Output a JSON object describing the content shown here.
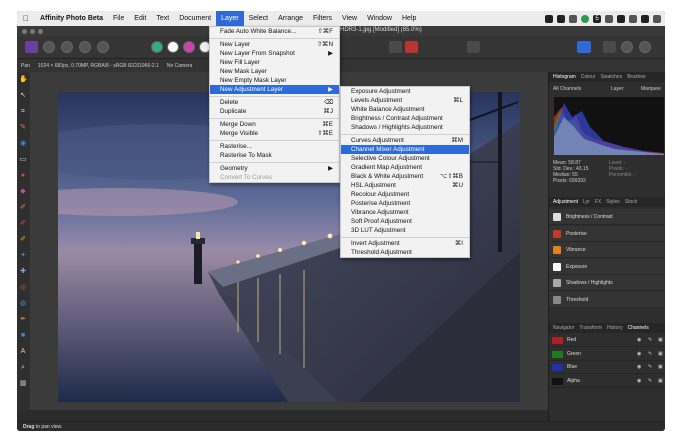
{
  "menubar": {
    "apple": "",
    "items": [
      "Affinity Photo Beta",
      "File",
      "Edit",
      "Text",
      "Document",
      "Layer",
      "Select",
      "Arrange",
      "Filters",
      "View",
      "Window",
      "Help"
    ],
    "active_index": 5
  },
  "titlebar": {
    "doc_title": "HDR3-1.jpg [Modified] (85.0%)"
  },
  "context": {
    "tool_name": "Pan",
    "doc_info": "1024 × 683px, 0.70MP, RGBA/8 - sRGB IEC61966-2.1",
    "camera": "No Camera"
  },
  "layer_menu": {
    "items": [
      {
        "label": "Fade Auto White Balance...",
        "shortcut": "⇧⌘F"
      },
      {
        "sep": true
      },
      {
        "label": "New Layer",
        "shortcut": "⇧⌘N"
      },
      {
        "label": "New Layer From Snapshot",
        "shortcut": "▶"
      },
      {
        "label": "New Fill Layer",
        "shortcut": ""
      },
      {
        "label": "New Mask Layer",
        "shortcut": ""
      },
      {
        "label": "New Empty Mask Layer",
        "shortcut": ""
      },
      {
        "label": "New Adjustment Layer",
        "shortcut": "▶",
        "highlight": true
      },
      {
        "sep": true
      },
      {
        "label": "Delete",
        "shortcut": "⌫"
      },
      {
        "label": "Duplicate",
        "shortcut": "⌘J"
      },
      {
        "sep": true
      },
      {
        "label": "Merge Down",
        "shortcut": "⌘E"
      },
      {
        "label": "Merge Visible",
        "shortcut": "⇧⌘E"
      },
      {
        "sep": true
      },
      {
        "label": "Rasterise...",
        "shortcut": ""
      },
      {
        "label": "Rasterise To Mask",
        "shortcut": ""
      },
      {
        "sep": true
      },
      {
        "label": "Geometry",
        "shortcut": "▶"
      },
      {
        "label": "Convert To Curves",
        "shortcut": "",
        "disabled": true
      }
    ]
  },
  "adjustment_menu": {
    "items": [
      {
        "label": "Exposure Adjustment",
        "shortcut": ""
      },
      {
        "label": "Levels Adjustment",
        "shortcut": "⌘L"
      },
      {
        "label": "White Balance Adjustment",
        "shortcut": ""
      },
      {
        "label": "Brightness / Contrast Adjustment",
        "shortcut": ""
      },
      {
        "label": "Shadows / Highlights Adjustment",
        "shortcut": ""
      },
      {
        "sep": true
      },
      {
        "label": "Curves Adjustment",
        "shortcut": "⌘M"
      },
      {
        "label": "Channel Mixer Adjustment",
        "shortcut": "",
        "highlight": true
      },
      {
        "label": "Selective Colour Adjustment",
        "shortcut": ""
      },
      {
        "label": "Gradient Map Adjustment",
        "shortcut": ""
      },
      {
        "label": "Black & White Adjustment",
        "shortcut": "⌥⇧⌘B"
      },
      {
        "label": "HSL Adjustment",
        "shortcut": "⌘U"
      },
      {
        "label": "Recolour Adjustment",
        "shortcut": ""
      },
      {
        "label": "Posterise Adjustment",
        "shortcut": ""
      },
      {
        "label": "Vibrance Adjustment",
        "shortcut": ""
      },
      {
        "label": "Soft Proof Adjustment",
        "shortcut": ""
      },
      {
        "label": "3D LUT Adjustment",
        "shortcut": ""
      },
      {
        "sep": true
      },
      {
        "label": "Invert Adjustment",
        "shortcut": "⌘I"
      },
      {
        "label": "Threshold Adjustment",
        "shortcut": ""
      }
    ]
  },
  "histogram_panel": {
    "tabs": [
      "Histogram",
      "Colour",
      "Swatches",
      "Brushes"
    ],
    "channel_select": "All Channels",
    "layer_label": "Layer",
    "marquee_label": "Marquee",
    "stats_left": [
      "Mean: 58.87",
      "Std. Dev.: 43.15",
      "Median: 55",
      "Pixels: 699392"
    ],
    "stats_right": [
      "Level: -",
      "Pixels: -",
      "Percentile: -"
    ]
  },
  "adjustment_panel": {
    "tabs": [
      "Adjustment",
      "Lyr",
      "FX",
      "Styles",
      "Stock"
    ],
    "items": [
      {
        "label": "Brightness / Contrast",
        "color": "#dddddd"
      },
      {
        "label": "Posterise",
        "color": "#c0392b"
      },
      {
        "label": "Vibrance",
        "color": "#e67e22"
      },
      {
        "label": "Exposure",
        "color": "#ffffff"
      },
      {
        "label": "Shadows / Highlights",
        "color": "#aaaaaa"
      },
      {
        "label": "Threshold",
        "color": "#888888"
      }
    ]
  },
  "channels_panel": {
    "tabs": [
      "Navigator",
      "Transform",
      "History",
      "Channels"
    ],
    "channels": [
      {
        "label": "Red",
        "color": "#b02020"
      },
      {
        "label": "Green",
        "color": "#1f7a1f"
      },
      {
        "label": "Blue",
        "color": "#1f2fb0"
      },
      {
        "label": "Alpha",
        "color": "#111111"
      }
    ]
  },
  "status": {
    "bold": "Drag",
    "text": " to pan view."
  }
}
